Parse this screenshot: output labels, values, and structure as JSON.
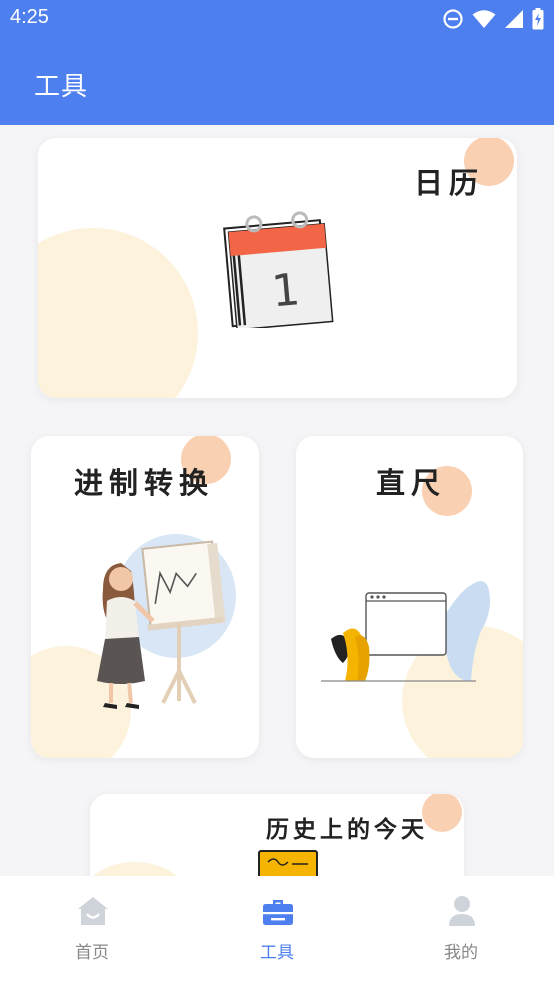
{
  "status_bar": {
    "time": "4:25"
  },
  "app_bar": {
    "title": "工具"
  },
  "cards": {
    "calendar": {
      "label": "日历",
      "date_number": "1"
    },
    "base_conversion": {
      "label": "进制转换"
    },
    "ruler": {
      "label": "直尺"
    },
    "history_today": {
      "label": "历史上的今天"
    }
  },
  "bottom_nav": {
    "items": [
      {
        "label": "首页",
        "icon": "home-icon"
      },
      {
        "label": "工具",
        "icon": "toolbox-icon",
        "active": true
      },
      {
        "label": "我的",
        "icon": "person-icon"
      }
    ]
  },
  "colors": {
    "primary": "#4e7fef",
    "peach": "#f8c9a4",
    "calendar_red": "#f26546",
    "inactive": "#888888"
  }
}
